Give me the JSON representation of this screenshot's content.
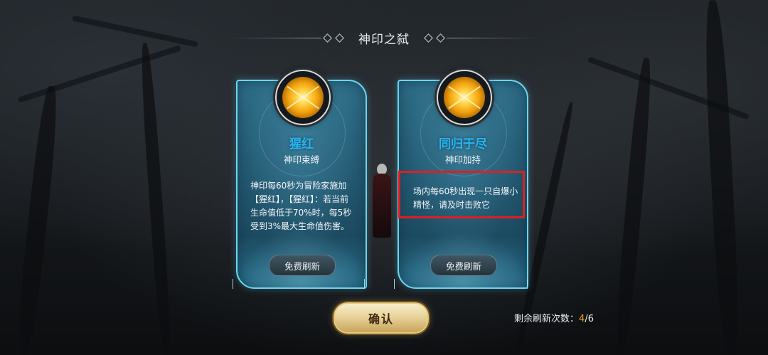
{
  "header": {
    "title": "神印之弑"
  },
  "cards": [
    {
      "name": "猩红",
      "subtitle": "神印束缚",
      "description": "神印每60秒为冒险家施加【猩红】，【猩红】：若当前生命值低于70%时，每5秒受到3%最大生命值伤害。",
      "refresh_label": "免费刷新",
      "name_color": "#27b6f2",
      "emblem_icon": "golden-orb-icon"
    },
    {
      "name": "同归于尽",
      "subtitle": "神印加持",
      "description": "场内每60秒出现一只自爆小精怪，请及时击败它",
      "refresh_label": "免费刷新",
      "name_color": "#27b6f2",
      "emblem_icon": "golden-orb-icon",
      "highlighted": true,
      "highlight_color": "#e01f1f"
    }
  ],
  "footer": {
    "confirm_label": "确认",
    "refresh_count_label": "剩余刷新次数：",
    "refresh_remaining": "4",
    "refresh_separator": "/",
    "refresh_total": "6",
    "remaining_color": "#f29a1d"
  }
}
